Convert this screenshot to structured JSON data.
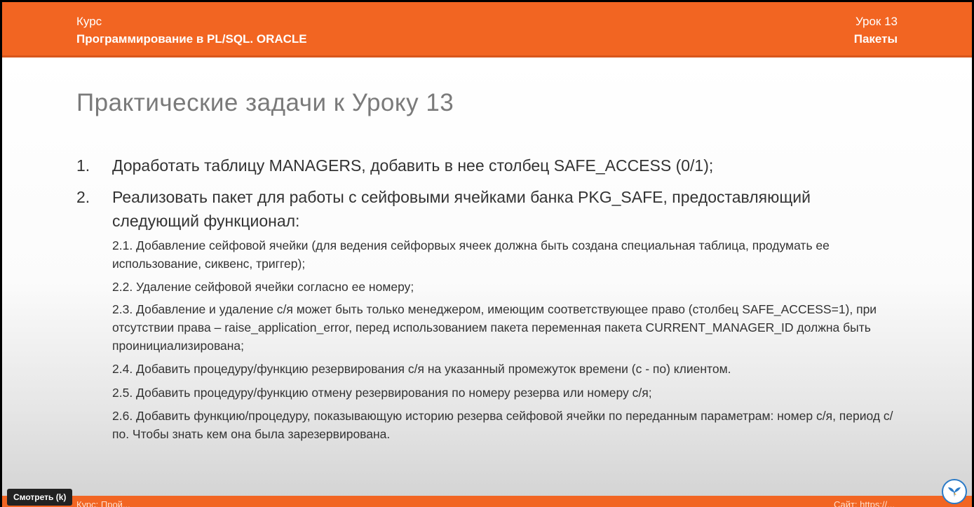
{
  "header": {
    "course_label": "Курс",
    "course_name": "Программирование в PL/SQL. ORACLE",
    "lesson_label": "Урок 13",
    "lesson_name": "Пакеты"
  },
  "slide": {
    "title": "Практические задачи к Уроку 13",
    "items": [
      {
        "num": "1.",
        "text": "Доработать таблицу MANAGERS, добавить в нее столбец SAFE_ACCESS (0/1);"
      },
      {
        "num": "2.",
        "text": "Реализовать пакет для работы с сейфовыми ячейками банка PKG_SAFE, предоставляющий следующий функционал:"
      }
    ],
    "subitems": [
      "2.1. Добавление сейфовой ячейки (для ведения сейфорвых ячеек должна быть создана специальная таблица, продумать ее использование, сиквенс, триггер);",
      "2.2. Удаление сейфовой ячейки согласно ее номеру;",
      "2.3. Добавление и удаление с/я может быть только менеджером, имеющим соответствующее право (столбец SAFE_ACCESS=1), при отсутствии права – raise_application_error, перед использованием пакета переменная пакета CURRENT_MANAGER_ID должна быть проинициализирована;",
      "2.4.  Добавить процедуру/функцию резервирования с/я на указанный промежуток времени (с - по) клиентом.",
      "2.5. Добавить процедуру/функцию отмену резервирования по номеру резерва или номеру с/я;",
      "2.6. Добавить функцию/процедуру, показывающую историю резерва сейфовой ячейки по переданным параметрам: номер с/я, период с/по. Чтобы знать кем она была зарезервирована."
    ]
  },
  "footer": {
    "left_text": "Курс: Прой...",
    "right_text": "Сайт: https://..."
  },
  "player": {
    "watch_button": "Смотреть (k)",
    "logo_icon": "brand-logo-icon"
  },
  "colors": {
    "accent": "#f26522",
    "title_gray": "#7a7a7a",
    "text_dark": "#333333"
  }
}
